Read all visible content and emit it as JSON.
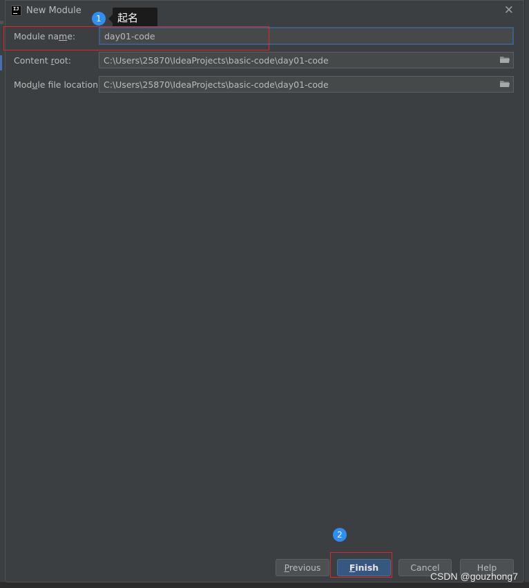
{
  "dialog": {
    "title": "New Module",
    "app_icon_text": "IJ"
  },
  "annotations": {
    "step1_number": "1",
    "step1_tooltip": "起名",
    "step2_number": "2"
  },
  "form": {
    "module_name": {
      "label_before": "Module na",
      "label_mnemonic": "m",
      "label_after": "e:",
      "value": "day01-code"
    },
    "content_root": {
      "label_before": "Content ",
      "label_mnemonic": "r",
      "label_after": "oot:",
      "value": "C:\\Users\\25870\\IdeaProjects\\basic-code\\day01-code"
    },
    "module_file_location": {
      "label_before": "Mod",
      "label_mnemonic": "u",
      "label_after": "le file location:",
      "value": "C:\\Users\\25870\\IdeaProjects\\basic-code\\day01-code"
    }
  },
  "buttons": {
    "previous": {
      "mnemonic": "P",
      "rest": "revious"
    },
    "finish": {
      "mnemonic": "F",
      "rest": "inish"
    },
    "cancel": "Cancel",
    "help": "Help"
  },
  "watermark": "CSDN @gouzhong7",
  "colors": {
    "dialog_bg": "#3c3f41",
    "input_bg": "#45494a",
    "focus_border": "#3d6185",
    "default_button": "#365880",
    "annotation_red": "#e0262a",
    "badge_blue": "#2f8ff0"
  }
}
